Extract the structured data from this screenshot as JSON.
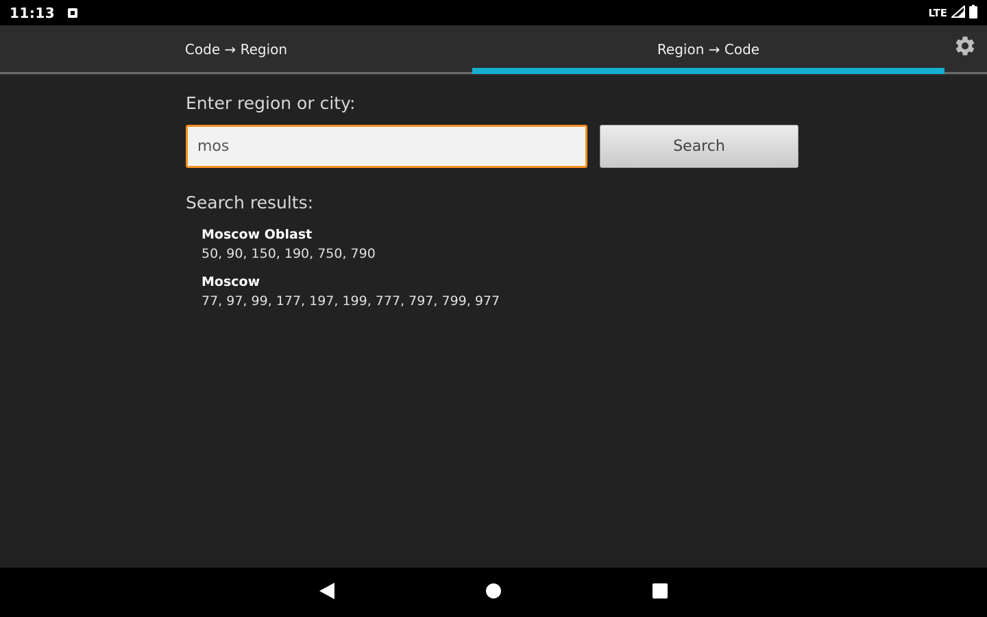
{
  "status_bar": {
    "time": "11:13",
    "network": "LTE",
    "icons": [
      "notification-icon",
      "signal-icon",
      "battery-icon"
    ]
  },
  "tabs": [
    {
      "label": "Code → Region",
      "selected": false
    },
    {
      "label": "Region → Code",
      "selected": true
    }
  ],
  "settings_icon": "gear-icon",
  "form": {
    "prompt": "Enter region or city:",
    "input_value": "mos",
    "search_label": "Search"
  },
  "results": {
    "heading": "Search results:",
    "items": [
      {
        "name": "Moscow Oblast",
        "codes": "50, 90, 150, 190, 750, 790"
      },
      {
        "name": "Moscow",
        "codes": "77, 97, 99, 177, 197, 199, 777, 797, 799, 977"
      }
    ]
  },
  "nav_bar": {
    "icons": [
      "back-icon",
      "home-icon",
      "recents-icon"
    ]
  },
  "colors": {
    "accent": "#18aecf",
    "input_focus": "#f5901f",
    "background": "#222222"
  }
}
